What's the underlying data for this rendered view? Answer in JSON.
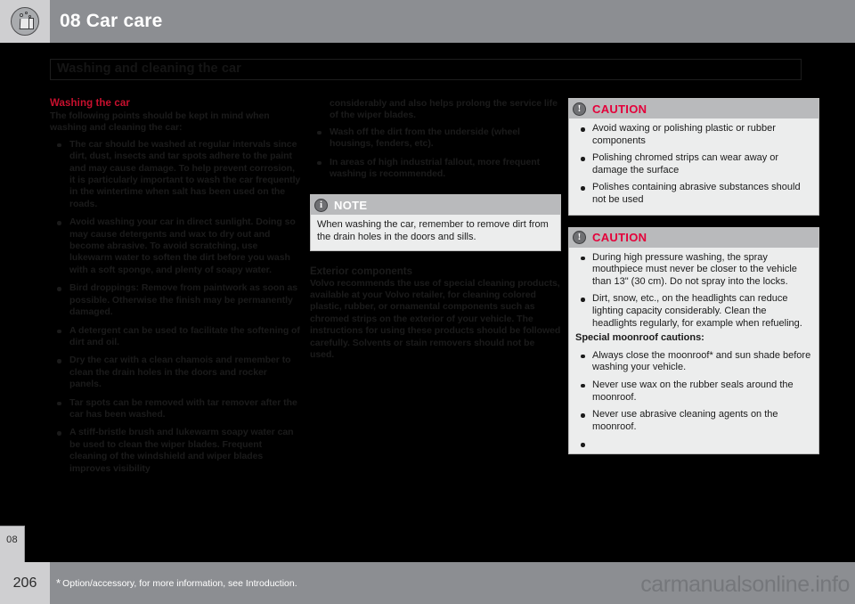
{
  "header": {
    "chapter_number": "08",
    "title": "08 Car care",
    "icon": "bucket-with-bubbles-icon",
    "bar_color": "#8c8e92",
    "cell_color": "#cfcfd1"
  },
  "section": {
    "title": "Washing and cleaning the car"
  },
  "colors": {
    "accent_red": "#c8102e",
    "caution_red": "#e4003a",
    "page_background": "#000000",
    "callout_background": "#eceded",
    "callout_header": "#b9babc"
  },
  "column_left": {
    "heading": "Washing the car",
    "intro": "The following points should be kept in mind when washing and cleaning the car:",
    "bullets": [
      "The car should be washed at regular intervals since dirt, dust, insects and tar spots adhere to the paint and may cause damage. To help prevent corrosion, it is particularly important to wash the car frequently in the wintertime when salt has been used on the roads.",
      "Avoid washing your car in direct sunlight. Doing so may cause detergents and wax to dry out and become abrasive. To avoid scratching, use lukewarm water to soften the dirt before you wash with a soft sponge, and plenty of soapy water.",
      "Bird droppings: Remove from paintwork as soon as possible. Otherwise the finish may be permanently damaged.",
      "A detergent can be used to facilitate the softening of dirt and oil.",
      "Dry the car with a clean chamois and remember to clean the drain holes in the doors and rocker panels.",
      "Tar spots can be removed with tar remover after the car has been washed.",
      "A stiff-bristle brush and lukewarm soapy water can be used to clean the wiper blades. Frequent cleaning of the windshield and wiper blades improves visibility"
    ]
  },
  "column_middle": {
    "continuation": "considerably and also helps prolong the service life of the wiper blades.",
    "bullets": [
      "Wash off the dirt from the underside (wheel housings, fenders, etc).",
      "In areas of high industrial fallout, more frequent washing is recommended."
    ],
    "note": {
      "icon": "info-icon",
      "label": "NOTE",
      "text": "When washing the car, remember to remove dirt from the drain holes in the doors and sills."
    },
    "exterior": {
      "heading": "Exterior components",
      "text": "Volvo recommends the use of special cleaning products, available at your Volvo retailer, for cleaning colored plastic, rubber, or ornamental components such as chromed strips on the exterior of your vehicle. The instructions for using these products should be followed carefully. Solvents or stain removers should not be used."
    }
  },
  "column_right": {
    "caution_1": {
      "icon": "warning-icon",
      "label": "CAUTION",
      "bullets": [
        "Avoid waxing or polishing plastic or rubber components",
        "Polishing chromed strips can wear away or damage the surface",
        "Polishes containing abrasive substances should not be used"
      ]
    },
    "caution_2": {
      "icon": "warning-icon",
      "label": "CAUTION",
      "bullets": [
        "During high pressure washing, the spray mouthpiece must never be closer to the vehicle than 13\" (30 cm). Do not spray into the locks.",
        "Dirt, snow, etc., on the headlights can reduce lighting capacity considerably. Clean the headlights regularly, for example when refueling."
      ],
      "subheading": "Special moonroof cautions:",
      "sub_bullets": [
        "Always close the moonroof* and sun shade before washing your vehicle.",
        "Never use wax on the rubber seals around the moonroof.",
        "Never use abrasive cleaning agents on the moonroof.",
        ""
      ]
    }
  },
  "footer": {
    "page_number": "206",
    "note_star": "*",
    "note_text": "Option/accessory, for more information, see Introduction.",
    "watermark": "carmanualsonline.info"
  }
}
